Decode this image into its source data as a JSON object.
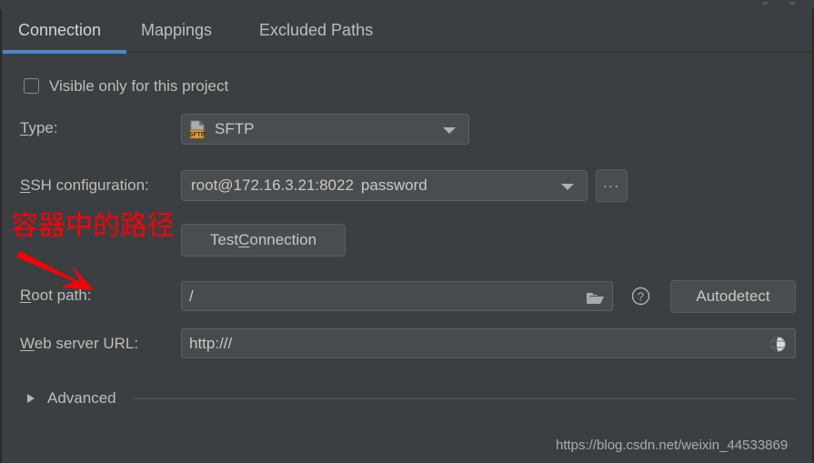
{
  "window": {
    "background_color": "#3c3f41",
    "accent_color": "#4a88c7",
    "annotation_color": "#fb0007"
  },
  "tabs": [
    {
      "label": "Connection",
      "selected": true
    },
    {
      "label": "Mappings",
      "selected": false
    },
    {
      "label": "Excluded Paths",
      "selected": false
    }
  ],
  "form": {
    "visible_only_checkbox": {
      "label": "Visible only for this project",
      "checked": false
    },
    "type_row": {
      "label": "Type:",
      "mnemonic": "T",
      "value": "SFTP",
      "icon": "sftp-file-icon",
      "icon_badge": "SFTP"
    },
    "ssh_row": {
      "label": "SSH configuration:",
      "mnemonic": "S",
      "value": "root@172.16.3.21:8022",
      "suffix": "password",
      "browse_button": "..."
    },
    "test_connection_button": {
      "label_before": "Test ",
      "mnemonic": "C",
      "label_after": "onnection"
    },
    "root_path_row": {
      "label": "Root path:",
      "mnemonic": "R",
      "value": "/",
      "folder_icon": "folder-icon",
      "help_icon": "help-question-icon",
      "autodetect_button": "Autodetect"
    },
    "web_server_row": {
      "label": "Web server URL:",
      "mnemonic": "W",
      "value": "http:///",
      "globe_icon": "globe-icon"
    },
    "advanced_section": {
      "label": "Advanced",
      "expanded": false
    }
  },
  "annotation": {
    "text": "容器中的路径",
    "arrow": "red-arrow-pointing-down-right"
  },
  "watermark": {
    "text": "https://blog.csdn.net/weixin_44533869"
  }
}
